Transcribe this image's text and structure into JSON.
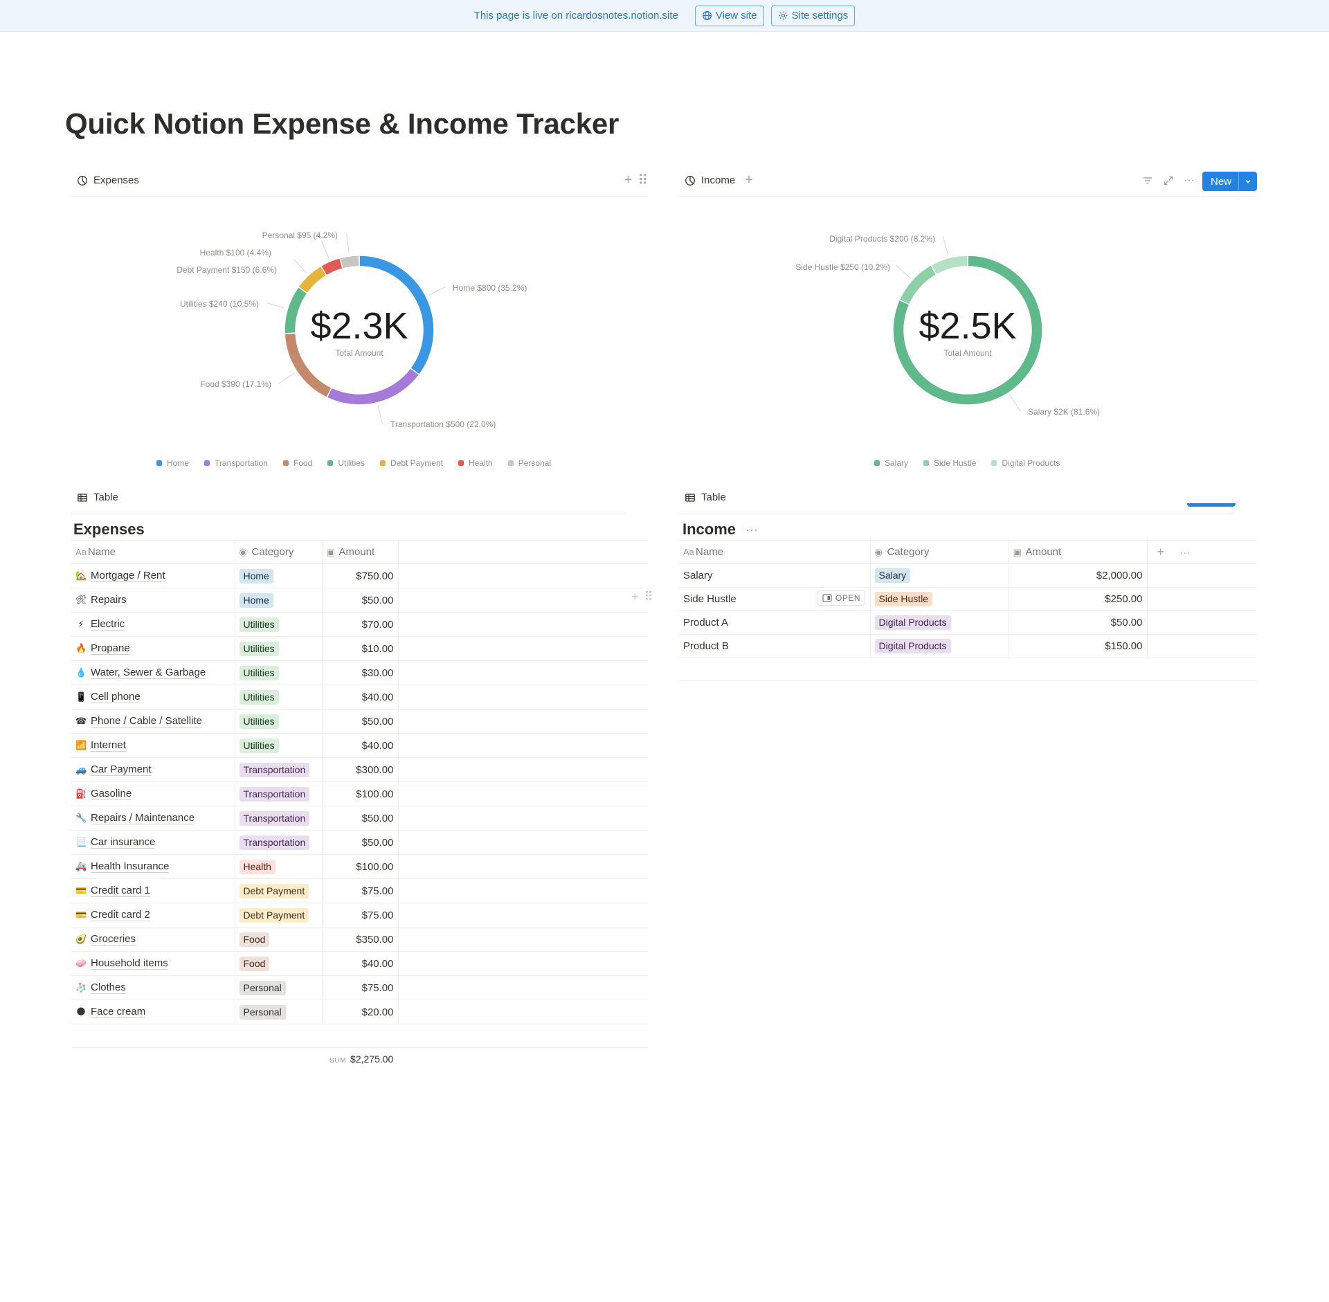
{
  "banner": {
    "live_text": "This page is live on ricardosnotes.notion.site",
    "view_site": "View site",
    "site_settings": "Site settings"
  },
  "page": {
    "title": "Quick Notion Expense & Income Tracker"
  },
  "expenses_view": {
    "tab_label": "Expenses",
    "chart_center_value": "$2.3K",
    "chart_center_caption": "Total Amount",
    "table_tab_label": "Table",
    "db_title": "Expenses",
    "columns": [
      "Name",
      "Category",
      "Amount"
    ],
    "rows": [
      {
        "emoji": "🏡",
        "name": "Mortgage / Rent",
        "category": "Home",
        "amount": "$750.00"
      },
      {
        "emoji": "🛠",
        "name": "Repairs",
        "category": "Home",
        "amount": "$50.00"
      },
      {
        "emoji": "⚡",
        "name": "Electric",
        "category": "Utilities",
        "amount": "$70.00"
      },
      {
        "emoji": "🔥",
        "name": "Propane",
        "category": "Utilities",
        "amount": "$10.00"
      },
      {
        "emoji": "💧",
        "name": "Water, Sewer & Garbage",
        "category": "Utilities",
        "amount": "$30.00"
      },
      {
        "emoji": "📱",
        "name": "Cell phone",
        "category": "Utilities",
        "amount": "$40.00"
      },
      {
        "emoji": "☎",
        "name": "Phone / Cable / Satellite",
        "category": "Utilities",
        "amount": "$50.00"
      },
      {
        "emoji": "📶",
        "name": "Internet",
        "category": "Utilities",
        "amount": "$40.00"
      },
      {
        "emoji": "🚙",
        "name": "Car Payment",
        "category": "Transportation",
        "amount": "$300.00"
      },
      {
        "emoji": "⛽",
        "name": "Gasoline",
        "category": "Transportation",
        "amount": "$100.00"
      },
      {
        "emoji": "🔧",
        "name": "Repairs / Maintenance",
        "category": "Transportation",
        "amount": "$50.00"
      },
      {
        "emoji": "📃",
        "name": "Car insurance",
        "category": "Transportation",
        "amount": "$50.00"
      },
      {
        "emoji": "🚑",
        "name": "Health Insurance",
        "category": "Health",
        "amount": "$100.00"
      },
      {
        "emoji": "💳",
        "name": "Credit card 1",
        "category": "Debt Payment",
        "amount": "$75.00"
      },
      {
        "emoji": "💳",
        "name": "Credit card 2",
        "category": "Debt Payment",
        "amount": "$75.00"
      },
      {
        "emoji": "🥑",
        "name": "Groceries",
        "category": "Food",
        "amount": "$350.00"
      },
      {
        "emoji": "🧼",
        "name": "Household items",
        "category": "Food",
        "amount": "$40.00"
      },
      {
        "emoji": "🧦",
        "name": "Clothes",
        "category": "Personal",
        "amount": "$75.00"
      },
      {
        "emoji": "🌑",
        "name": "Face cream",
        "category": "Personal",
        "amount": "$20.00"
      }
    ],
    "sum_label": "SUM",
    "sum_value": "$2,275.00"
  },
  "income_view": {
    "tab_label": "Income",
    "new_button": "New",
    "chart_center_value": "$2.5K",
    "chart_center_caption": "Total Amount",
    "table_tab_label": "Table",
    "db_title": "Income",
    "columns": [
      "Name",
      "Category",
      "Amount"
    ],
    "open_label": "OPEN",
    "rows": [
      {
        "name": "Salary",
        "category": "Salary",
        "amount": "$2,000.00"
      },
      {
        "name": "Side Hustle",
        "category": "Side Hustle",
        "amount": "$250.00"
      },
      {
        "name": "Product A",
        "category": "Digital Products",
        "amount": "$50.00"
      },
      {
        "name": "Product B",
        "category": "Digital Products",
        "amount": "$150.00"
      }
    ]
  },
  "tag_colors": {
    "Home": {
      "bg": "#d3e5ef",
      "fg": "#183347"
    },
    "Utilities": {
      "bg": "#dbeddb",
      "fg": "#1c3829"
    },
    "Transportation": {
      "bg": "#e8deee",
      "fg": "#412454"
    },
    "Health": {
      "bg": "#ffe2dd",
      "fg": "#5d1715"
    },
    "Debt Payment": {
      "bg": "#fdecc8",
      "fg": "#402c1b"
    },
    "Food": {
      "bg": "#eee0da",
      "fg": "#44291d"
    },
    "Personal": {
      "bg": "#e3e2e0",
      "fg": "#32302c"
    },
    "Salary": {
      "bg": "#d3e5ef",
      "fg": "#183347"
    },
    "Side Hustle": {
      "bg": "#fadec9",
      "fg": "#49290e"
    },
    "Digital Products": {
      "bg": "#e8deee",
      "fg": "#412454"
    }
  },
  "chart_data": [
    {
      "type": "pie",
      "variant": "donut",
      "legend_position": "bottom",
      "slices": [
        {
          "label": "Home",
          "value": 800,
          "percent": 35.2,
          "text": "$800 (35.2%)",
          "color": "#3a97e3"
        },
        {
          "label": "Transportation",
          "value": 500,
          "percent": 22.0,
          "text": "$500 (22.0%)",
          "color": "#a57ad8"
        },
        {
          "label": "Food",
          "value": 390,
          "percent": 17.1,
          "text": "$390 (17.1%)",
          "color": "#c4896a"
        },
        {
          "label": "Utilities",
          "value": 240,
          "percent": 10.5,
          "text": "$240 (10.5%)",
          "color": "#5fb98a"
        },
        {
          "label": "Debt Payment",
          "value": 150,
          "percent": 6.6,
          "text": "$150 (6.6%)",
          "color": "#e4b53a"
        },
        {
          "label": "Health",
          "value": 100,
          "percent": 4.4,
          "text": "$100 (4.4%)",
          "color": "#e05b55"
        },
        {
          "label": "Personal",
          "value": 95,
          "percent": 4.2,
          "text": "$95 (4.2%)",
          "color": "#c7c6c3"
        }
      ]
    },
    {
      "type": "pie",
      "variant": "donut",
      "legend_position": "bottom",
      "slices": [
        {
          "label": "Salary",
          "value": 2000,
          "percent": 81.6,
          "text": "$2K (81.6%)",
          "color": "#5fb98a"
        },
        {
          "label": "Side Hustle",
          "value": 250,
          "percent": 10.2,
          "text": "$250 (10.2%)",
          "color": "#8dd0a8"
        },
        {
          "label": "Digital Products",
          "value": 200,
          "percent": 8.2,
          "text": "$200 (8.2%)",
          "color": "#b5e1c6"
        }
      ]
    }
  ]
}
